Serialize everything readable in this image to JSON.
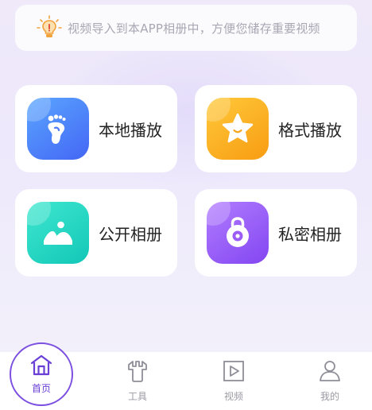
{
  "tip": {
    "icon": "lightbulb-icon",
    "text": "视频导入到本APP相册中，方便您储存重要视频"
  },
  "cards": [
    {
      "label": "本地播放",
      "icon": "footprint-icon",
      "color": "#4f7bf7"
    },
    {
      "label": "格式播放",
      "icon": "star-icon",
      "color": "#fbb124"
    },
    {
      "label": "公开相册",
      "icon": "photo-icon",
      "color": "#25d6c3"
    },
    {
      "label": "私密相册",
      "icon": "lock-icon",
      "color": "#9b5cf7"
    }
  ],
  "tabs": [
    {
      "label": "首页",
      "icon": "home-icon",
      "active": true
    },
    {
      "label": "工具",
      "icon": "tools-icon",
      "active": false
    },
    {
      "label": "视频",
      "icon": "video-icon",
      "active": false
    },
    {
      "label": "我的",
      "icon": "profile-icon",
      "active": false
    }
  ],
  "colors": {
    "accent": "#7c4fe0",
    "inactive_tab": "#9b9aa3"
  }
}
